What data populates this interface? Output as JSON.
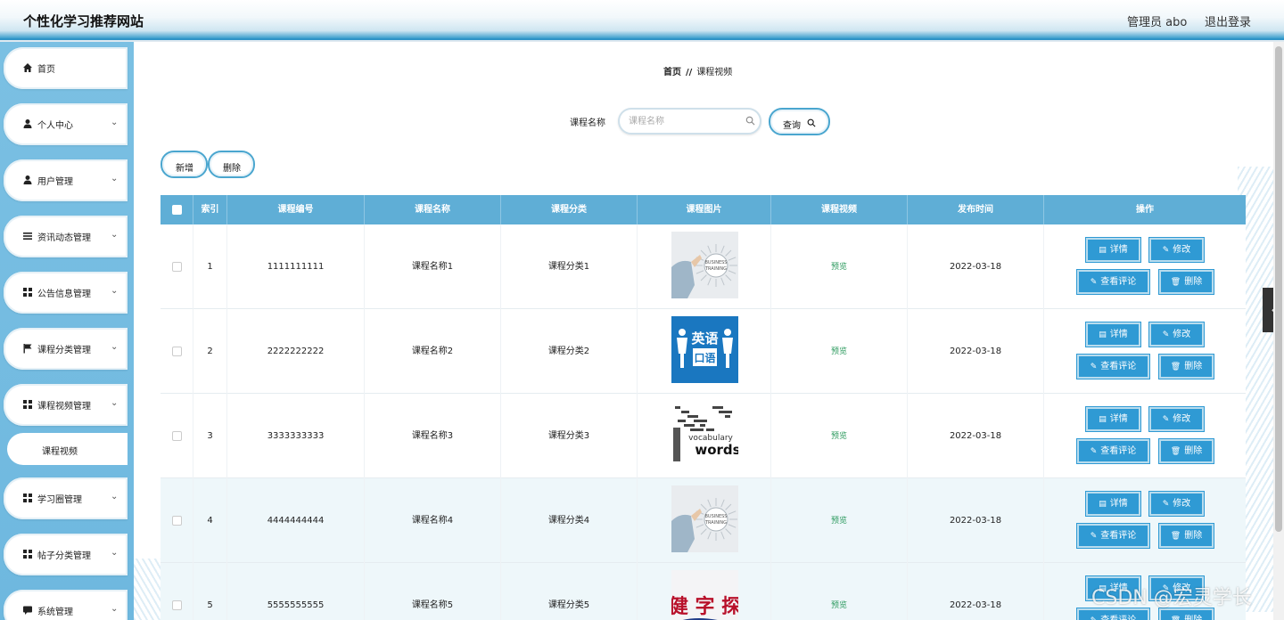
{
  "app": {
    "title": "个性化学习推荐网站",
    "admin": "管理员 abo",
    "logout": "退出登录"
  },
  "sidebar": {
    "items": [
      {
        "label": "首页",
        "icon": "home-icon"
      },
      {
        "label": "个人中心",
        "icon": "user-icon"
      },
      {
        "label": "用户管理",
        "icon": "user-icon"
      },
      {
        "label": "资讯动态管理",
        "icon": "list-icon"
      },
      {
        "label": "公告信息管理",
        "icon": "grid-icon"
      },
      {
        "label": "课程分类管理",
        "icon": "flag-icon"
      },
      {
        "label": "课程视频管理",
        "icon": "grid-icon"
      },
      {
        "label": "学习圈管理",
        "icon": "grid-icon"
      },
      {
        "label": "帖子分类管理",
        "icon": "grid-icon"
      },
      {
        "label": "系统管理",
        "icon": "chat-icon"
      }
    ],
    "sub_item": "课程视频"
  },
  "breadcrumb": {
    "home": "首页",
    "sep": "//",
    "current": "课程视频"
  },
  "search": {
    "label": "课程名称",
    "placeholder": "课程名称",
    "value": "",
    "button": "查询"
  },
  "toolbar": {
    "add": "新增",
    "delete": "删除"
  },
  "table": {
    "headers": [
      "索引",
      "课程编号",
      "课程名称",
      "课程分类",
      "课程图片",
      "课程视频",
      "发布时间",
      "操作"
    ],
    "rows": [
      {
        "index": "1",
        "code": "1111111111",
        "name": "课程名称1",
        "category": "课程分类1",
        "image": "business-training",
        "video": "预览",
        "date": "2022-03-18"
      },
      {
        "index": "2",
        "code": "2222222222",
        "name": "课程名称2",
        "category": "课程分类2",
        "image": "english-speaking",
        "video": "预览",
        "date": "2022-03-18"
      },
      {
        "index": "3",
        "code": "3333333333",
        "name": "课程名称3",
        "category": "课程分类3",
        "image": "vocabulary-words",
        "video": "预览",
        "date": "2022-03-18"
      },
      {
        "index": "4",
        "code": "4444444444",
        "name": "课程名称4",
        "category": "课程分类4",
        "image": "business-training",
        "video": "预览",
        "date": "2022-03-18"
      },
      {
        "index": "5",
        "code": "5555555555",
        "name": "课程名称5",
        "category": "课程分类5",
        "image": "calligraphy",
        "video": "预览",
        "date": "2022-03-18"
      }
    ],
    "actions": {
      "detail": "详情",
      "edit": "修改",
      "comments": "查看评论",
      "delete": "删除"
    }
  },
  "image_text": {
    "business_line1": "BUSINESS",
    "business_line2": "TRAINING",
    "english_top": "英语",
    "english_bottom": "口语",
    "vocab_word1": "vocabulary",
    "vocab_word2": "words",
    "calligraphy": "健 字 探"
  },
  "watermark": "CSDN @宏灵学长",
  "colors": {
    "header_bar": "#5faed6",
    "action_button": "#2f9ad4",
    "preview_link": "#2c9a5e",
    "sidebar": "#7bc0e3"
  }
}
